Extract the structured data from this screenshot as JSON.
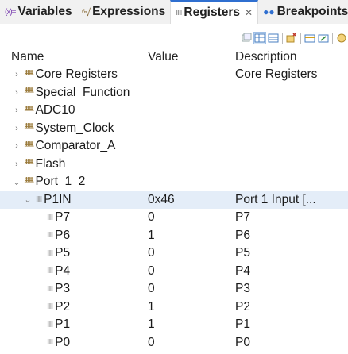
{
  "tabs": [
    {
      "icon": "(x)=",
      "label": "Variables",
      "active": false
    },
    {
      "icon": "⁶√",
      "label": "Expressions",
      "active": false
    },
    {
      "icon": "IIII",
      "label": "Registers",
      "active": true,
      "close": "✕"
    },
    {
      "icon": "●●",
      "label": "Breakpoints",
      "active": false
    }
  ],
  "tab_more": "⁼",
  "toolbar_icons": [
    "collapse-all-icon",
    "layout-icon",
    "show-columns-icon",
    "add-group-icon",
    "new-register-icon",
    "import-icon",
    "export-icon"
  ],
  "table": {
    "headers": {
      "name": "Name",
      "value": "Value",
      "description": "Description"
    },
    "rows": [
      {
        "twisty": ">",
        "icon": "group",
        "name": "Core Registers",
        "value": "",
        "description": "Core Registers"
      },
      {
        "twisty": ">",
        "icon": "group",
        "name": "Special_Function",
        "value": "",
        "description": ""
      },
      {
        "twisty": ">",
        "icon": "group",
        "name": "ADC10",
        "value": "",
        "description": ""
      },
      {
        "twisty": ">",
        "icon": "group",
        "name": "System_Clock",
        "value": "",
        "description": ""
      },
      {
        "twisty": ">",
        "icon": "group",
        "name": "Comparator_A",
        "value": "",
        "description": ""
      },
      {
        "twisty": ">",
        "icon": "group",
        "name": "Flash",
        "value": "",
        "description": ""
      },
      {
        "twisty": "v",
        "icon": "group",
        "name": "Port_1_2",
        "value": "",
        "description": ""
      },
      {
        "twisty": "v",
        "icon": "reg",
        "name": "P1IN",
        "value": "0x46",
        "description": "Port 1 Input [...",
        "selected": true
      },
      {
        "twisty": "",
        "icon": "field",
        "name": "P7",
        "value": "0",
        "description": "P7"
      },
      {
        "twisty": "",
        "icon": "field",
        "name": "P6",
        "value": "1",
        "description": "P6"
      },
      {
        "twisty": "",
        "icon": "field",
        "name": "P5",
        "value": "0",
        "description": "P5"
      },
      {
        "twisty": "",
        "icon": "field",
        "name": "P4",
        "value": "0",
        "description": "P4"
      },
      {
        "twisty": "",
        "icon": "field",
        "name": "P3",
        "value": "0",
        "description": "P3"
      },
      {
        "twisty": "",
        "icon": "field",
        "name": "P2",
        "value": "1",
        "description": "P2"
      },
      {
        "twisty": "",
        "icon": "field",
        "name": "P1",
        "value": "1",
        "description": "P1"
      },
      {
        "twisty": "",
        "icon": "field",
        "name": "P0",
        "value": "0",
        "description": "P0"
      }
    ]
  },
  "group_icon_glyph": "ᚙ",
  "reg_icon_glyph": "IIII",
  "field_icon_glyph": "IIII"
}
